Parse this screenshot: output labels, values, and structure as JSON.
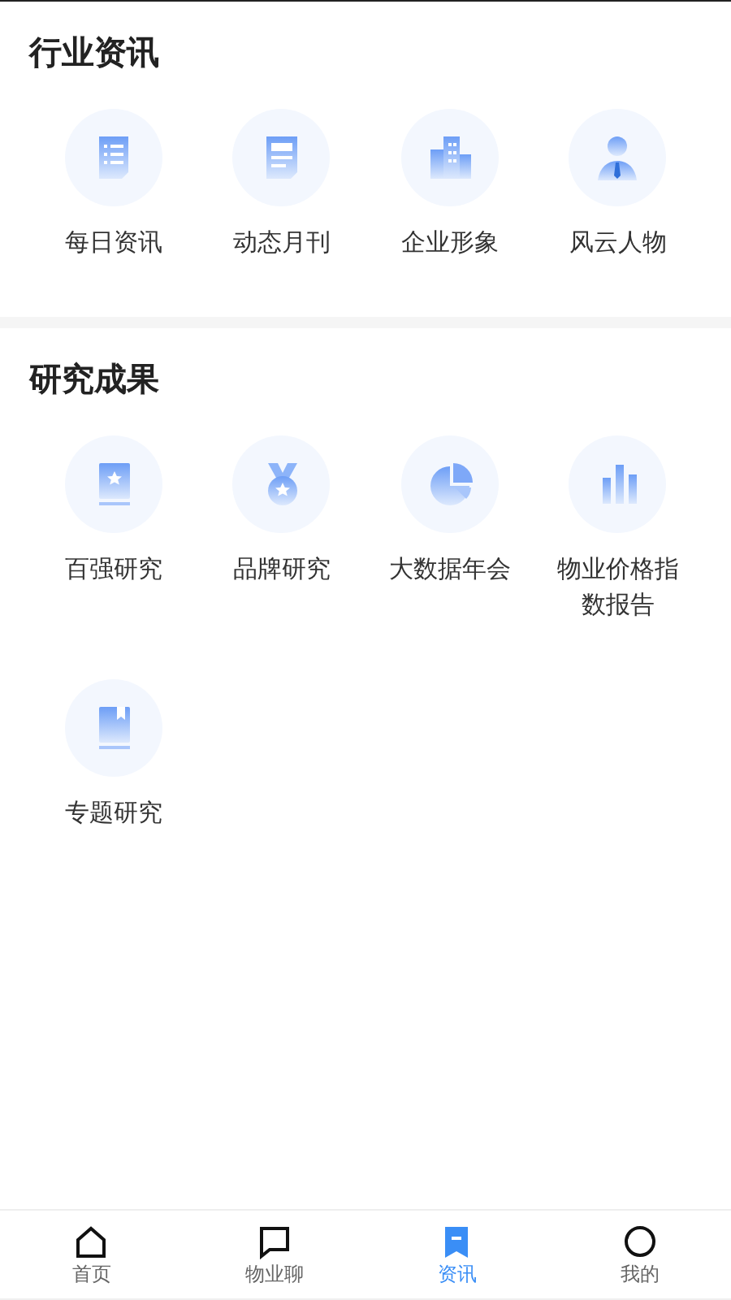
{
  "sections": [
    {
      "title": "行业资讯",
      "items": [
        {
          "label": "每日资讯"
        },
        {
          "label": "动态月刊"
        },
        {
          "label": "企业形象"
        },
        {
          "label": "风云人物"
        }
      ]
    },
    {
      "title": "研究成果",
      "items": [
        {
          "label": "百强研究"
        },
        {
          "label": "品牌研究"
        },
        {
          "label": "大数据年会"
        },
        {
          "label": "物业价格指数报告"
        },
        {
          "label": "专题研究"
        }
      ]
    }
  ],
  "tab_bar": [
    {
      "label": "首页",
      "selected": false
    },
    {
      "label": "物业聊",
      "selected": false
    },
    {
      "label": "资讯",
      "selected": true
    },
    {
      "label": "我的",
      "selected": false
    }
  ]
}
